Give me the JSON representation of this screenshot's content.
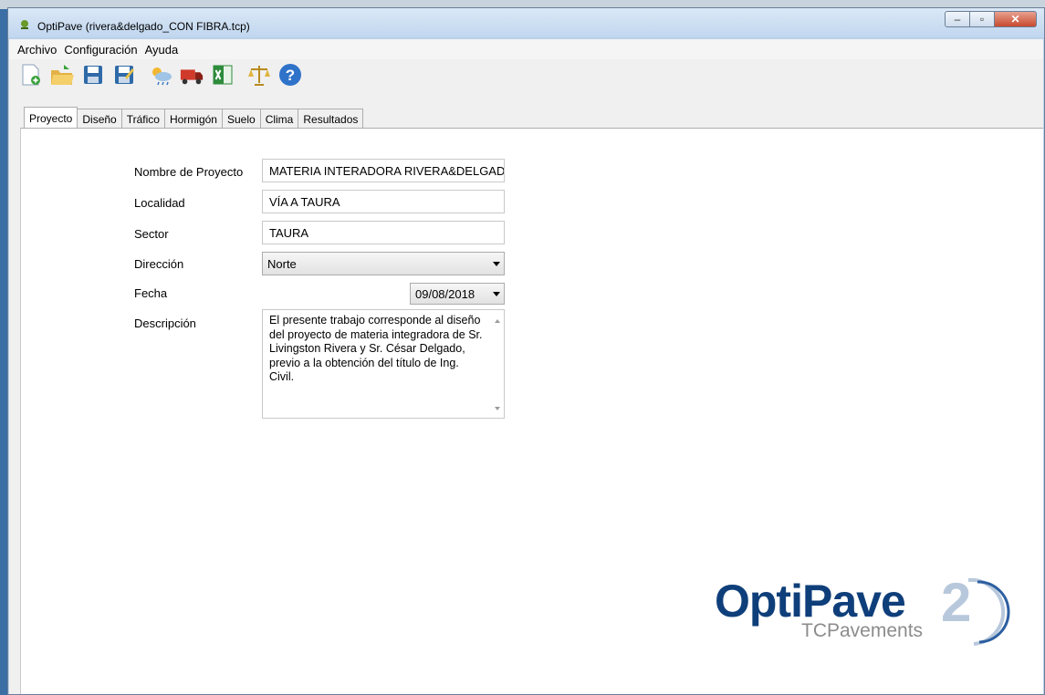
{
  "window": {
    "title": "OptiPave  (rivera&delgado_CON FIBRA.tcp)"
  },
  "menu": [
    "Archivo",
    "Configuración",
    "Ayuda"
  ],
  "toolbar": [
    "new-file-icon",
    "open-folder-icon",
    "save-icon",
    "save-as-icon",
    "weather-icon",
    "truck-icon",
    "excel-icon",
    "scales-icon",
    "help-icon"
  ],
  "tabs": [
    "Proyecto",
    "Diseño",
    "Tráfico",
    "Hormigón",
    "Suelo",
    "Clima",
    "Resultados"
  ],
  "form": {
    "nombre_label": "Nombre de Proyecto",
    "nombre_value": "MATERIA INTERADORA RIVERA&DELGAD",
    "localidad_label": "Localidad",
    "localidad_value": "VÍA A TAURA",
    "sector_label": "Sector",
    "sector_value": "TAURA",
    "direccion_label": "Dirección",
    "direccion_value": "Norte",
    "fecha_label": "Fecha",
    "fecha_value": "09/08/2018",
    "descripcion_label": "Descripción",
    "descripcion_value": "El presente trabajo corresponde al diseño del proyecto de materia integradora de Sr. Livingston Rivera y Sr. César Delgado, previo a la obtención del título de Ing. Civil."
  },
  "logo": {
    "main": "OptiPave",
    "number": "2",
    "sub": "TCPavements"
  },
  "colors": {
    "logo_blue": "#0f3f7a",
    "titlebar": "#c0d6ef",
    "close": "#c84a2e"
  }
}
